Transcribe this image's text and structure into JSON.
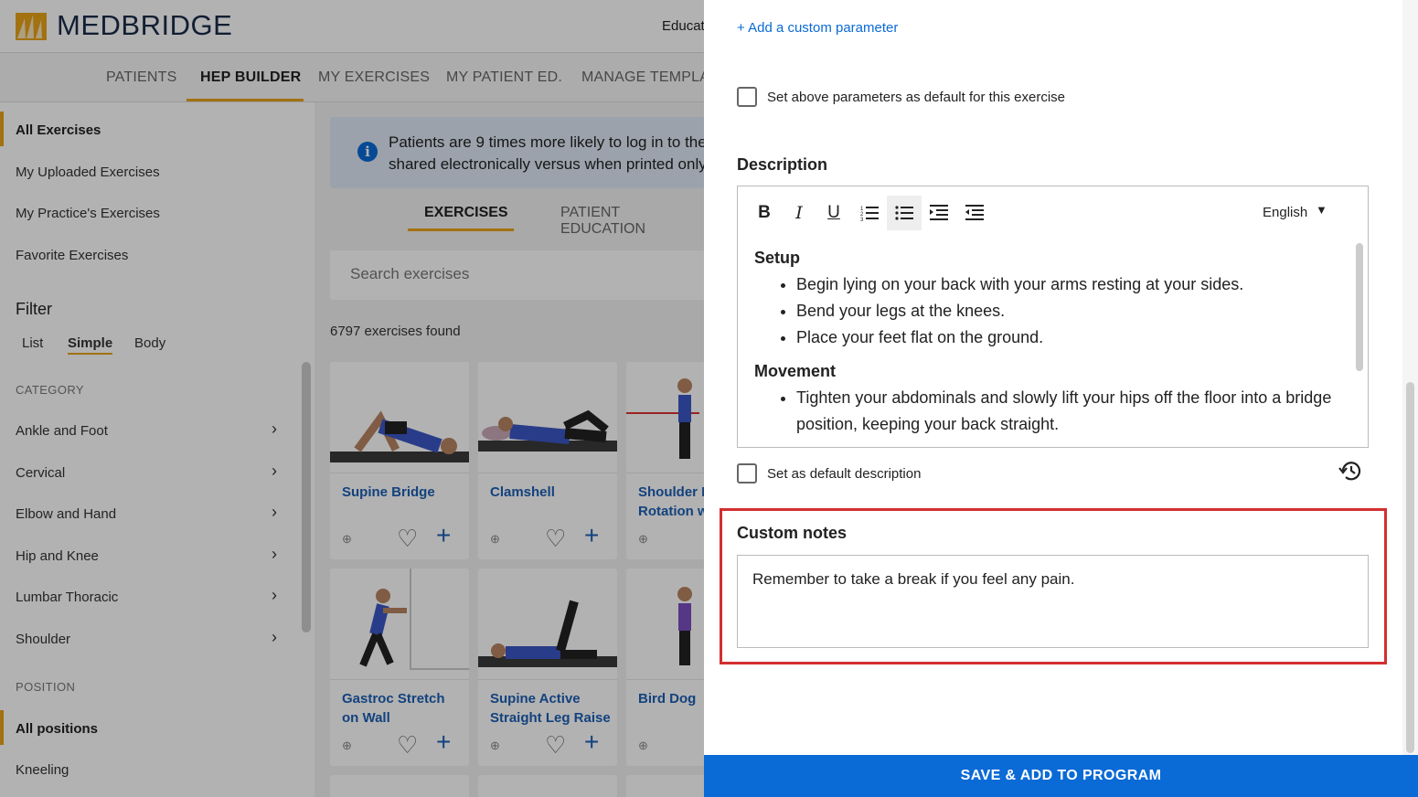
{
  "app": {
    "logo_text": "MEDBRIDGE",
    "top_right_text": "Educat"
  },
  "nav": {
    "tabs": [
      "PATIENTS",
      "HEP BUILDER",
      "MY EXERCISES",
      "MY PATIENT ED.",
      "MANAGE TEMPLA"
    ],
    "active": "HEP BUILDER"
  },
  "sidebar": {
    "items": [
      "All Exercises",
      "My Uploaded Exercises",
      "My Practice's Exercises",
      "Favorite Exercises"
    ],
    "filter_title": "Filter",
    "filter_options": [
      "List",
      "Simple",
      "Body"
    ],
    "category_heading": "CATEGORY",
    "categories": [
      "Ankle and Foot",
      "Cervical",
      "Elbow and Hand",
      "Hip and Knee",
      "Lumbar Thoracic",
      "Shoulder"
    ],
    "position_heading": "POSITION",
    "positions": [
      "All positions",
      "Kneeling"
    ]
  },
  "content": {
    "banner_line1": "Patients are 9 times more likely to log in to the",
    "banner_line2": "shared electronically versus when printed only",
    "tabs": [
      "EXERCISES",
      "PATIENT EDUCATION"
    ],
    "search_placeholder": "Search exercises",
    "found_text": "6797 exercises found",
    "cards": [
      {
        "title": "Supine Bridge"
      },
      {
        "title": "Clamshell"
      },
      {
        "title": "Shoulder E Rotation w"
      },
      {
        "title": "Gastroc Stretch on Wall"
      },
      {
        "title": "Supine Active Straight Leg Raise"
      },
      {
        "title": "Bird Dog"
      }
    ]
  },
  "panel": {
    "add_param": "+ Add a custom parameter",
    "default_params_label": "Set above parameters as default for this exercise",
    "description_title": "Description",
    "language": "English",
    "setup_heading": "Setup",
    "setup_items": [
      "Begin lying on your back with your arms resting at your sides.",
      "Bend your legs at the knees.",
      "Place your feet flat on the ground."
    ],
    "movement_heading": "Movement",
    "movement_items": [
      "Tighten your abdominals and slowly lift your hips off the floor into a bridge position, keeping your back straight."
    ],
    "default_desc_label": "Set as default description",
    "notes_title": "Custom notes",
    "notes_value": "Remember to take a break if you feel any pain.",
    "save_label": "SAVE & ADD TO PROGRAM"
  },
  "colors": {
    "accent": "#e8a317",
    "primary": "#0a6ad6",
    "highlight": "#d32f2f"
  }
}
